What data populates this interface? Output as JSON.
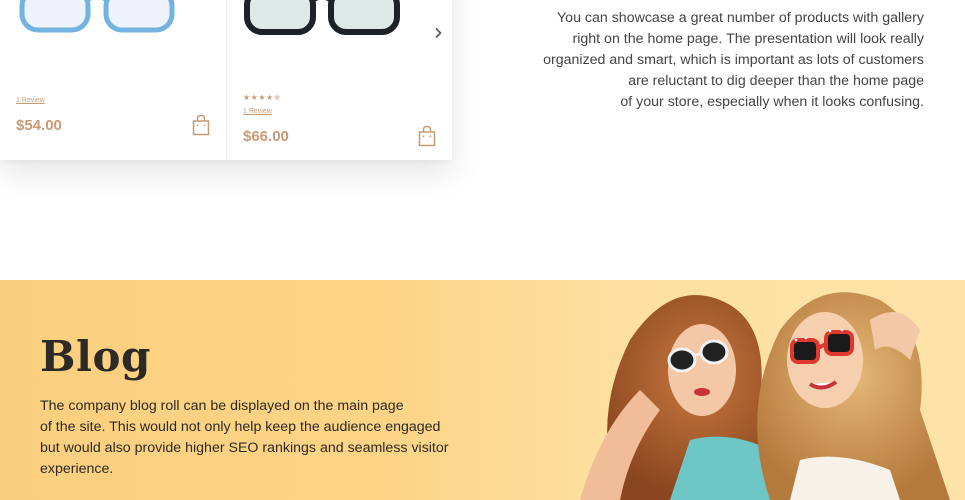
{
  "products": [
    {
      "name": "Blue frame glasses",
      "rating_stars": "",
      "review_label": "1 Review",
      "price": "$54.00",
      "frame_color": "#72b4df"
    },
    {
      "name": "Black frame glasses",
      "rating_stars": "★★★★✯",
      "review_label": "1 Review",
      "price": "$66.00",
      "frame_color": "#1d2226"
    }
  ],
  "gallery": {
    "next_icon": "chevron-right-icon",
    "cart_icon": "shopping-bag-icon",
    "accent_color": "#c89b76"
  },
  "intro": {
    "lines": [
      "You can showcase a great number of products with gallery",
      "right on the home page. The presentation will look really",
      "organized and smart, which is important as lots of customers",
      "are reluctant to dig deeper than the home page",
      "of your store, especially when it looks confusing."
    ]
  },
  "blog": {
    "title": "Blog",
    "lines": [
      "The company blog roll can be displayed on the main page",
      "of the site. This would not only help keep the audience engaged",
      "but would also provide higher SEO rankings and seamless visitor",
      "experience."
    ],
    "background_color": "#fdd486"
  }
}
